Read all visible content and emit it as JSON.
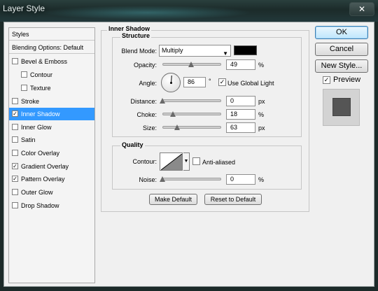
{
  "window": {
    "title": "Layer Style",
    "close_glyph": "✕"
  },
  "styles_list": [
    {
      "label": "Styles",
      "checkbox": false,
      "checked": false,
      "selected": false,
      "indent": false,
      "header": true
    },
    {
      "label": "Blending Options: Default",
      "checkbox": false,
      "checked": false,
      "selected": false,
      "indent": false,
      "header": true
    },
    {
      "label": "Bevel & Emboss",
      "checkbox": true,
      "checked": false,
      "selected": false,
      "indent": false
    },
    {
      "label": "Contour",
      "checkbox": true,
      "checked": false,
      "selected": false,
      "indent": true
    },
    {
      "label": "Texture",
      "checkbox": true,
      "checked": false,
      "selected": false,
      "indent": true
    },
    {
      "label": "Stroke",
      "checkbox": true,
      "checked": false,
      "selected": false,
      "indent": false
    },
    {
      "label": "Inner Shadow",
      "checkbox": true,
      "checked": true,
      "selected": true,
      "indent": false
    },
    {
      "label": "Inner Glow",
      "checkbox": true,
      "checked": false,
      "selected": false,
      "indent": false
    },
    {
      "label": "Satin",
      "checkbox": true,
      "checked": false,
      "selected": false,
      "indent": false
    },
    {
      "label": "Color Overlay",
      "checkbox": true,
      "checked": false,
      "selected": false,
      "indent": false
    },
    {
      "label": "Gradient Overlay",
      "checkbox": true,
      "checked": true,
      "selected": false,
      "indent": false
    },
    {
      "label": "Pattern Overlay",
      "checkbox": true,
      "checked": true,
      "selected": false,
      "indent": false
    },
    {
      "label": "Outer Glow",
      "checkbox": true,
      "checked": false,
      "selected": false,
      "indent": false
    },
    {
      "label": "Drop Shadow",
      "checkbox": true,
      "checked": false,
      "selected": false,
      "indent": false
    }
  ],
  "inner_shadow": {
    "title": "Inner Shadow",
    "structure": {
      "title": "Structure",
      "blend_mode_label": "Blend Mode:",
      "blend_mode_value": "Multiply",
      "shadow_color": "#000000",
      "opacity_label": "Opacity:",
      "opacity_value": "49",
      "opacity_unit": "%",
      "opacity_fraction": 0.49,
      "angle_label": "Angle:",
      "angle_value": "86",
      "angle_unit": "°",
      "use_global_light_label": "Use Global Light",
      "use_global_light_checked": true,
      "distance_label": "Distance:",
      "distance_value": "0",
      "distance_unit": "px",
      "distance_fraction": 0.0,
      "choke_label": "Choke:",
      "choke_value": "18",
      "choke_unit": "%",
      "choke_fraction": 0.18,
      "size_label": "Size:",
      "size_value": "63",
      "size_unit": "px",
      "size_fraction": 0.25
    },
    "quality": {
      "title": "Quality",
      "contour_label": "Contour:",
      "anti_aliased_label": "Anti-aliased",
      "anti_aliased_checked": false,
      "noise_label": "Noise:",
      "noise_value": "0",
      "noise_unit": "%",
      "noise_fraction": 0.0
    },
    "make_default_label": "Make Default",
    "reset_default_label": "Reset to Default"
  },
  "right_panel": {
    "ok_label": "OK",
    "cancel_label": "Cancel",
    "new_style_label": "New Style...",
    "preview_label": "Preview",
    "preview_checked": true
  }
}
